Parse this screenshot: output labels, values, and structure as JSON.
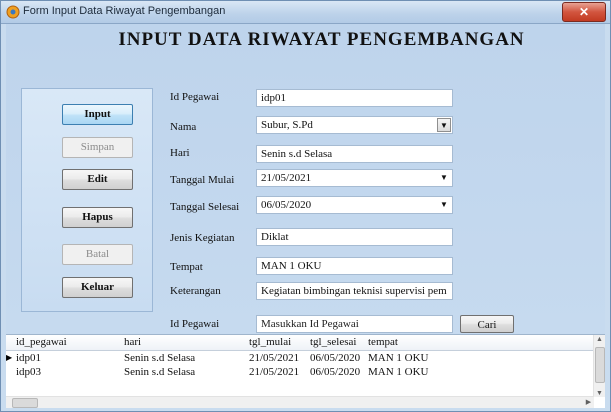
{
  "window": {
    "title": "Form Input Data Riwayat Pengembangan",
    "close_label": "✕"
  },
  "heading": "INPUT DATA RIWAYAT  PENGEMBANGAN",
  "buttons": {
    "input": "Input",
    "simpan": "Simpan",
    "edit": "Edit",
    "hapus": "Hapus",
    "batal": "Batal",
    "keluar": "Keluar"
  },
  "form": {
    "id_pegawai": {
      "label": "Id Pegawai",
      "value": "idp01"
    },
    "nama": {
      "label": "Nama",
      "value": "Subur, S.Pd"
    },
    "hari": {
      "label": "Hari",
      "value": "Senin s.d Selasa"
    },
    "tanggal_mulai": {
      "label": "Tanggal Mulai",
      "value": "21/05/2021"
    },
    "tanggal_selesai": {
      "label": "Tanggal Selesai",
      "value": "06/05/2020"
    },
    "jenis_kegiatan": {
      "label": "Jenis Kegiatan",
      "value": "Diklat"
    },
    "tempat": {
      "label": "Tempat",
      "value": "MAN 1 OKU"
    },
    "keterangan": {
      "label": "Keterangan",
      "value": "Kegiatan bimbingan teknisi supervisi pem"
    }
  },
  "search": {
    "label": "Id Pegawai",
    "value": "Masukkan Id Pegawai",
    "button": "Cari"
  },
  "grid": {
    "columns": [
      "id_pegawai",
      "hari",
      "tgl_mulai",
      "tgl_selesai",
      "tempat"
    ],
    "rows": [
      {
        "id_pegawai": "idp01",
        "hari": "Senin s.d Selasa",
        "tgl_mulai": "21/05/2021",
        "tgl_selesai": "06/05/2020",
        "tempat": "MAN 1 OKU"
      },
      {
        "id_pegawai": "idp03",
        "hari": "Senin s.d Selasa",
        "tgl_mulai": "21/05/2021",
        "tgl_selesai": "06/05/2020",
        "tempat": "MAN 1 OKU"
      }
    ],
    "selected_row_marker": "▶"
  },
  "colors": {
    "title_bar": "#bcd2ea",
    "form_background": "#c6daef",
    "close_button": "#c23a22"
  },
  "icons": [
    "app-icon",
    "close-icon",
    "combo-arrow-icon",
    "scroll-arrow-icon"
  ]
}
